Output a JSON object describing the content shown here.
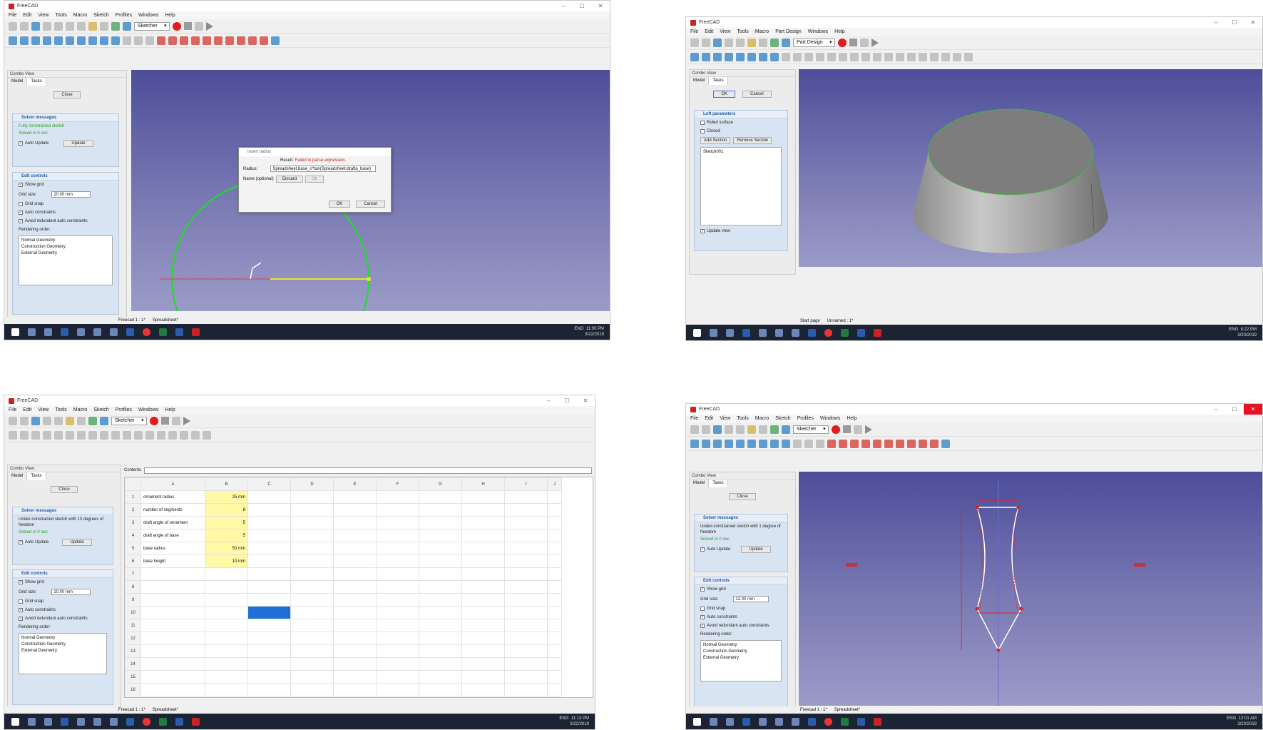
{
  "app": {
    "title": "FreeCAD",
    "menus_sketcher": [
      "File",
      "Edit",
      "View",
      "Tools",
      "Macro",
      "Sketch",
      "Profiles",
      "Windows",
      "Help"
    ],
    "menus_partdesign": [
      "File",
      "Edit",
      "View",
      "Tools",
      "Macro",
      "Part Design",
      "Windows",
      "Help"
    ]
  },
  "combo": {
    "header": "Combo View",
    "tab_model": "Model",
    "tab_tasks": "Tasks",
    "close_label": "Close",
    "solver_title": "Solver messages",
    "auto_update": "Auto Update",
    "update_label": "Update",
    "edit_controls_title": "Edit controls",
    "show_grid": "Show grid",
    "grid_size_label": "Grid size:",
    "grid_snap": "Grid snap",
    "auto_constraints": "Auto constraints",
    "avoid_redundant": "Avoid redundant auto constraints",
    "rendering_order": "Rendering order:",
    "render_items": [
      "Normal Geometry",
      "Construction Geometry",
      "External Geometry"
    ]
  },
  "screen1": {
    "workbench": "Sketcher",
    "solver_msg1": "Fully constrained sketch",
    "solver_msg2": "Solved in 0 sec",
    "grid_size": "20.00 mm",
    "tabs": [
      "Freecad 1 : 1*",
      "Spreadsheet*"
    ],
    "clock_time": "11:00 PM",
    "clock_date": "3/22/2019",
    "lang": "ENG",
    "dialog": {
      "title": "Insert radius",
      "result_label": "Result:",
      "result_error": "Failed to parse expression.",
      "radius_label": "Radius:",
      "radius_value": "Spreadsheet.base_r/*tan(Spreadsheet.drafta_base)",
      "name_label": "Name (optional)",
      "discard": "Discard",
      "ok_inner": "Ok",
      "ok": "OK",
      "cancel": "Cancel"
    }
  },
  "screen2": {
    "workbench": "Part Design",
    "ok": "OK",
    "cancel": "Cancel",
    "loft_title": "Loft parameters",
    "ruled_surface": "Ruled surface",
    "closed": "Closed",
    "add_section": "Add Section",
    "remove_section": "Remove Section",
    "section_item": "Sketch001",
    "update_view": "Update view",
    "tabs": [
      "Start page",
      "Unnamed : 1*"
    ],
    "clock_time": "8:22 PM",
    "clock_date": "3/23/2019",
    "lang": "ENG"
  },
  "screen3": {
    "workbench": "Sketcher",
    "solver_msg1": "Under-constrained sketch with 13 degrees of freedom",
    "solver_msg2": "Solved in 0 sec",
    "grid_size": "10.00 mm",
    "contents_label": "Contents",
    "columns": [
      "A",
      "B",
      "C",
      "D",
      "E",
      "F",
      "G",
      "H",
      "I",
      "J"
    ],
    "rows": [
      {
        "n": "1",
        "a": "ornament radius",
        "b": "25 mm"
      },
      {
        "n": "2",
        "a": "number of segments",
        "b": "8"
      },
      {
        "n": "3",
        "a": "draft angle of ornament",
        "b": "5"
      },
      {
        "n": "4",
        "a": "draft angle of base",
        "b": "5"
      },
      {
        "n": "5",
        "a": "base radius",
        "b": "50 mm"
      },
      {
        "n": "6",
        "a": "base height",
        "b": "10 mm"
      },
      {
        "n": "7",
        "a": "",
        "b": ""
      },
      {
        "n": "8",
        "a": "",
        "b": ""
      },
      {
        "n": "9",
        "a": "",
        "b": ""
      },
      {
        "n": "10",
        "a": "",
        "b": ""
      },
      {
        "n": "11",
        "a": "",
        "b": ""
      },
      {
        "n": "12",
        "a": "",
        "b": ""
      },
      {
        "n": "13",
        "a": "",
        "b": ""
      },
      {
        "n": "14",
        "a": "",
        "b": ""
      },
      {
        "n": "15",
        "a": "",
        "b": ""
      },
      {
        "n": "16",
        "a": "",
        "b": ""
      }
    ],
    "tabs": [
      "Freecad 1 : 1*",
      "Spreadsheet*"
    ],
    "clock_time": "11:13 PM",
    "clock_date": "3/22/2019",
    "lang": "ENG"
  },
  "screen4": {
    "workbench": "Sketcher",
    "solver_msg1": "Under-constrained sketch with 1 degree of freedom",
    "solver_msg2": "Solved in 0 sec",
    "grid_size": "12.00 mm",
    "tabs": [
      "Freecad 1 : 1*",
      "Spreadsheet*"
    ],
    "clock_time": "12:01 AM",
    "clock_date": "3/23/2019",
    "lang": "ENG"
  },
  "colors": {
    "viewport_top": "#4d4d9a",
    "viewport_bottom": "#9b9bc8",
    "constraint_red": "#e02020",
    "sketch_green": "#1ee01e",
    "sketch_yellow": "#e8e81e",
    "cell_yellow": "#fff8a6",
    "cell_blue": "#1e6fd6"
  }
}
